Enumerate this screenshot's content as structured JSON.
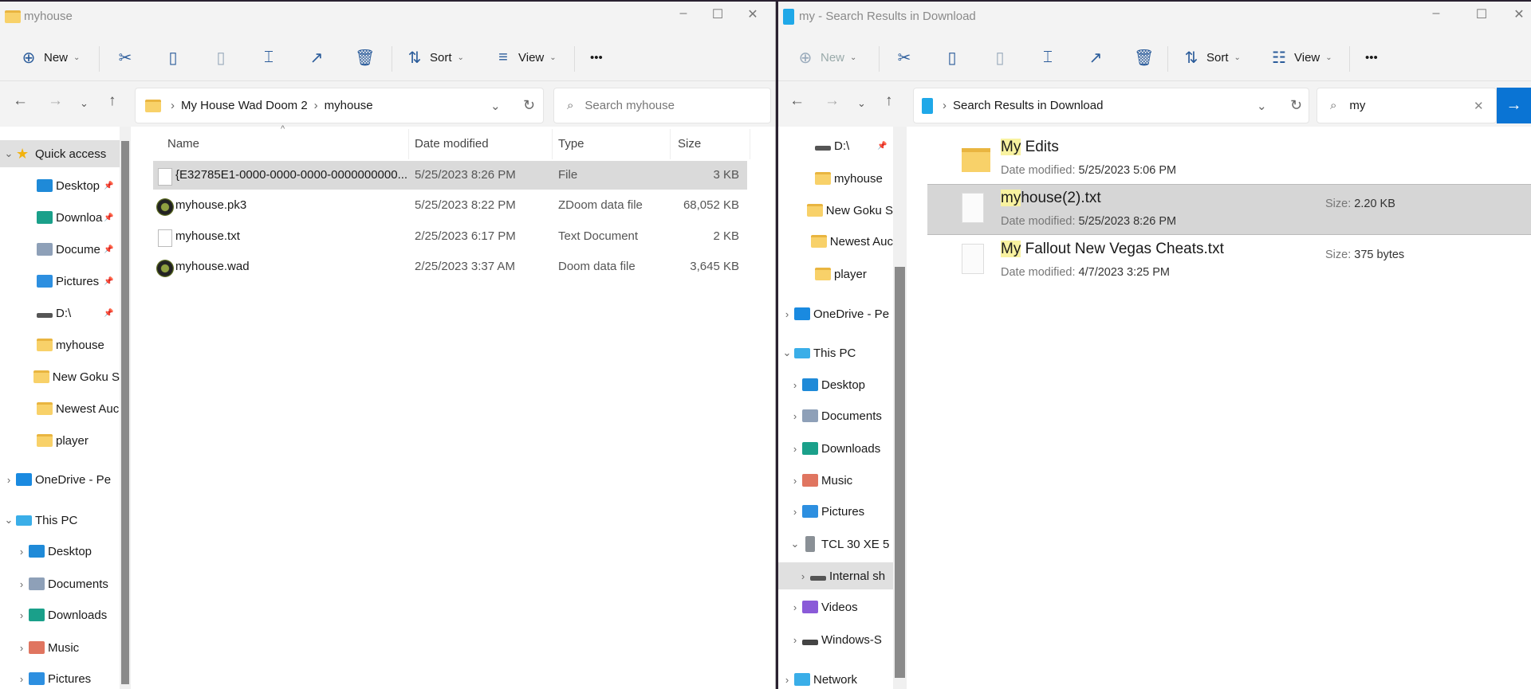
{
  "left": {
    "title": "myhouse",
    "toolbar": {
      "new": "New",
      "sort": "Sort",
      "view": "View",
      "more": "•••"
    },
    "breadcrumb": [
      "My House Wad Doom 2",
      "myhouse"
    ],
    "search_placeholder": "Search myhouse",
    "nav": [
      {
        "label": "Quick access",
        "icon": "star"
      },
      {
        "label": "Desktop",
        "icon": "desktop"
      },
      {
        "label": "Downloa",
        "icon": "dl"
      },
      {
        "label": "Docume",
        "icon": "docs"
      },
      {
        "label": "Pictures",
        "icon": "pics"
      },
      {
        "label": "D:\\",
        "icon": "drive"
      },
      {
        "label": "myhouse",
        "icon": "folder"
      },
      {
        "label": "New Goku S",
        "icon": "folder"
      },
      {
        "label": "Newest Auc",
        "icon": "folder"
      },
      {
        "label": "player",
        "icon": "folder"
      },
      {
        "label": "OneDrive - Pe",
        "icon": "onedrive"
      },
      {
        "label": "This PC",
        "icon": "pc"
      },
      {
        "label": "Desktop",
        "icon": "desktop"
      },
      {
        "label": "Documents",
        "icon": "docs"
      },
      {
        "label": "Downloads",
        "icon": "dl"
      },
      {
        "label": "Music",
        "icon": "music"
      },
      {
        "label": "Pictures",
        "icon": "pics"
      }
    ],
    "columns": [
      "Name",
      "Date modified",
      "Type",
      "Size"
    ],
    "files": [
      {
        "name": "{E32785E1-0000-0000-0000-0000000000...",
        "date": "5/25/2023 8:26 PM",
        "type": "File",
        "size": "3 KB",
        "icon": "file",
        "selected": true
      },
      {
        "name": "myhouse.pk3",
        "date": "5/25/2023 8:22 PM",
        "type": "ZDoom data file",
        "size": "68,052 KB",
        "icon": "doom"
      },
      {
        "name": "myhouse.txt",
        "date": "2/25/2023 6:17 PM",
        "type": "Text Document",
        "size": "2 KB",
        "icon": "file"
      },
      {
        "name": "myhouse.wad",
        "date": "2/25/2023 3:37 AM",
        "type": "Doom data file",
        "size": "3,645 KB",
        "icon": "doom"
      }
    ]
  },
  "right": {
    "title": "my - Search Results in Download",
    "toolbar": {
      "new": "New",
      "sort": "Sort",
      "view": "View",
      "more": "•••"
    },
    "breadcrumb": [
      "Search Results in Download"
    ],
    "search_value": "my",
    "nav": [
      {
        "label": "D:\\",
        "icon": "drive"
      },
      {
        "label": "myhouse",
        "icon": "folder"
      },
      {
        "label": "New Goku S",
        "icon": "folder"
      },
      {
        "label": "Newest Auc",
        "icon": "folder"
      },
      {
        "label": "player",
        "icon": "folder"
      },
      {
        "label": "OneDrive - Pe",
        "icon": "onedrive"
      },
      {
        "label": "This PC",
        "icon": "pc"
      },
      {
        "label": "Desktop",
        "icon": "desktop"
      },
      {
        "label": "Documents",
        "icon": "docs"
      },
      {
        "label": "Downloads",
        "icon": "dl"
      },
      {
        "label": "Music",
        "icon": "music"
      },
      {
        "label": "Pictures",
        "icon": "pics"
      },
      {
        "label": "TCL 30 XE 5",
        "icon": "phone"
      },
      {
        "label": "Internal sh",
        "icon": "drive"
      },
      {
        "label": "Videos",
        "icon": "videos"
      },
      {
        "label": "Windows-S",
        "icon": "winos"
      },
      {
        "label": "Network",
        "icon": "network"
      }
    ],
    "date_label": "Date modified:",
    "size_label": "Size:",
    "results": [
      {
        "match": "My",
        "rest": " Edits",
        "date": "5/25/2023 5:06 PM",
        "size": "",
        "icon": "folder"
      },
      {
        "match": "my",
        "rest": "house(2).txt",
        "date": "5/25/2023 8:26 PM",
        "size": "2.20 KB",
        "icon": "file",
        "selected": true
      },
      {
        "match": "My",
        "rest": " Fallout New Vegas Cheats.txt",
        "date": "4/7/2023 3:25 PM",
        "size": "375 bytes",
        "icon": "file"
      }
    ],
    "highlight_color": "#f8f2a0",
    "accent": "#0a74d4"
  }
}
